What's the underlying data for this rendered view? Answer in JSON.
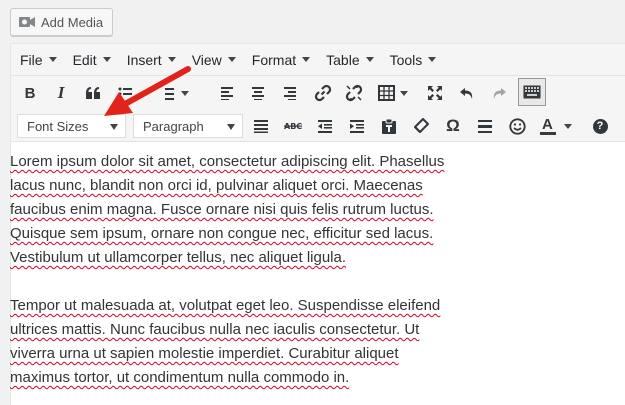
{
  "add_media": {
    "label": "Add Media",
    "icon": "media-camera-icon"
  },
  "menubar": [
    {
      "label": "File"
    },
    {
      "label": "Edit"
    },
    {
      "label": "Insert"
    },
    {
      "label": "View"
    },
    {
      "label": "Format"
    },
    {
      "label": "Table"
    },
    {
      "label": "Tools"
    }
  ],
  "toolbar": {
    "row1": [
      "bold",
      "italic",
      "blockquote",
      "bullet-list",
      "numbered-list",
      "align-left",
      "align-center",
      "align-right",
      "insert-link",
      "remove-link",
      "table",
      "fullscreen",
      "undo",
      "redo",
      "toolbar-toggle"
    ],
    "row2": [
      "font-sizes",
      "paragraph-format",
      "justify",
      "strikethrough",
      "outdent",
      "indent",
      "paste-as-text",
      "clear-formatting",
      "special-character",
      "horizontal-line",
      "emoticons",
      "text-color",
      "help"
    ],
    "bold_label": "B",
    "italic_label": "I",
    "font_sizes_label": "Font Sizes",
    "paragraph_label": "Paragraph",
    "omega_label": "Ω",
    "text_color_label": "A",
    "text_color": "#3b3b3b",
    "help_label": "?"
  },
  "annotation": {
    "arrow_color": "#e2231a",
    "points_to": "font-sizes-select"
  },
  "content": {
    "paragraphs": [
      [
        "Lorem ipsum dolor sit amet, consectetur adipiscing elit. Phasellus",
        "lacus nunc, blandit non orci id, pulvinar aliquet orci. Maecenas",
        "faucibus enim magna. Fusce ornare nisi quis felis rutrum luctus.",
        "Quisque sem ipsum, ornare non congue nec, efficitur sed lacus.",
        "Vestibulum ut ullamcorper tellus, nec aliquet ligula."
      ],
      [
        "Tempor ut malesuada at, volutpat eget leo. Suspendisse eleifend",
        "ultrices mattis. Nunc faucibus nulla nec iaculis consectetur. Ut",
        "viverra urna ut sapien molestie imperdiet. Curabitur aliquet",
        "maximus tortor, ut condimentum nulla commodo in."
      ]
    ]
  }
}
